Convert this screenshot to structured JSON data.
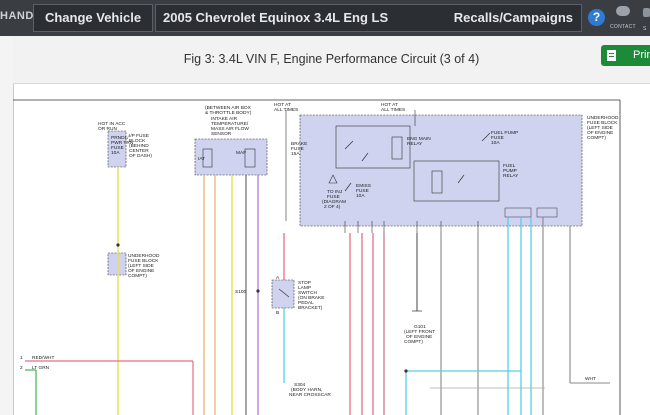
{
  "header": {
    "brand_fragment": "HAND",
    "change_vehicle": "Change Vehicle",
    "vehicle_title": "2005 Chevrolet Equinox 3.4L Eng LS",
    "recalls": "Recalls/Campaigns",
    "help": "?",
    "contact": "CONTACT",
    "edge_fragment": "S"
  },
  "figure": {
    "title": "Fig 3: 3.4L VIN F, Engine Performance Circuit (3 of 4)",
    "print_label": "Prin"
  },
  "diagram": {
    "hot_acc": [
      "HOT IN ACC",
      "OR RUN"
    ],
    "ip_fuse": [
      "I/P FUSE",
      "BLOCK",
      "(BEHIND",
      "CENTER",
      "OF DASH)"
    ],
    "prndl": [
      "PRNDL/",
      "PWR TRN",
      "FUSE",
      "10A"
    ],
    "between": [
      "(BETWEEN AIR BOX",
      "& THROTTLE BODY)"
    ],
    "iat_sensor": [
      "INTAKE AIR",
      "TEMPERATURE/",
      "MASS AIR FLOW",
      "SENSOR"
    ],
    "iat": "IAT",
    "maf": "MAF",
    "hot_at_1": [
      "HOT AT",
      "ALL TIMES"
    ],
    "hot_at_2": [
      "HOT AT",
      "ALL TIMES"
    ],
    "underhood_right": [
      "UNDERHOOD",
      "FUSE BLOCK",
      "(LEFT SIDE",
      "OF ENGINE",
      "COMPT)"
    ],
    "brake_fuse": [
      "BRAKE",
      "FUSE",
      "15A"
    ],
    "eng_main": [
      "ENG MAIN",
      "RELAY"
    ],
    "fuel_pump_fuse": [
      "FUEL PUMP",
      "FUSE",
      "10A"
    ],
    "fuel_pump_relay": [
      "FUEL",
      "PUMP",
      "RELAY"
    ],
    "to_inj": [
      "TO INJ",
      "FUSE",
      "(DIAGRAM",
      "2 OF 4)"
    ],
    "emiss": [
      "EMISS",
      "FUSE",
      "10A"
    ],
    "underhood_left": [
      "UNDERHOOD",
      "FUSE BLOCK",
      "(LEFT SIDE",
      "OF ENGINE",
      "COMPT)"
    ],
    "stop_lamp": [
      "STOP",
      "LAMP",
      "SWITCH",
      "(ON BRAKE",
      "PEDAL",
      "BRACKET)"
    ],
    "g101": [
      "G101",
      "(LEFT FRONT",
      "OF ENGINE",
      "COMPT)"
    ],
    "s100": "S100",
    "s304": [
      "S304",
      "(BODY HARN,",
      "NEAR CROSSCAR"
    ],
    "wire_red_wht": "RED/WHT",
    "wire_lt_grn": "LT GRN",
    "wire_wht": "WHT",
    "wire_row_1": "1",
    "wire_row_2": "2",
    "pin_a": "A",
    "pin_b": "B"
  }
}
